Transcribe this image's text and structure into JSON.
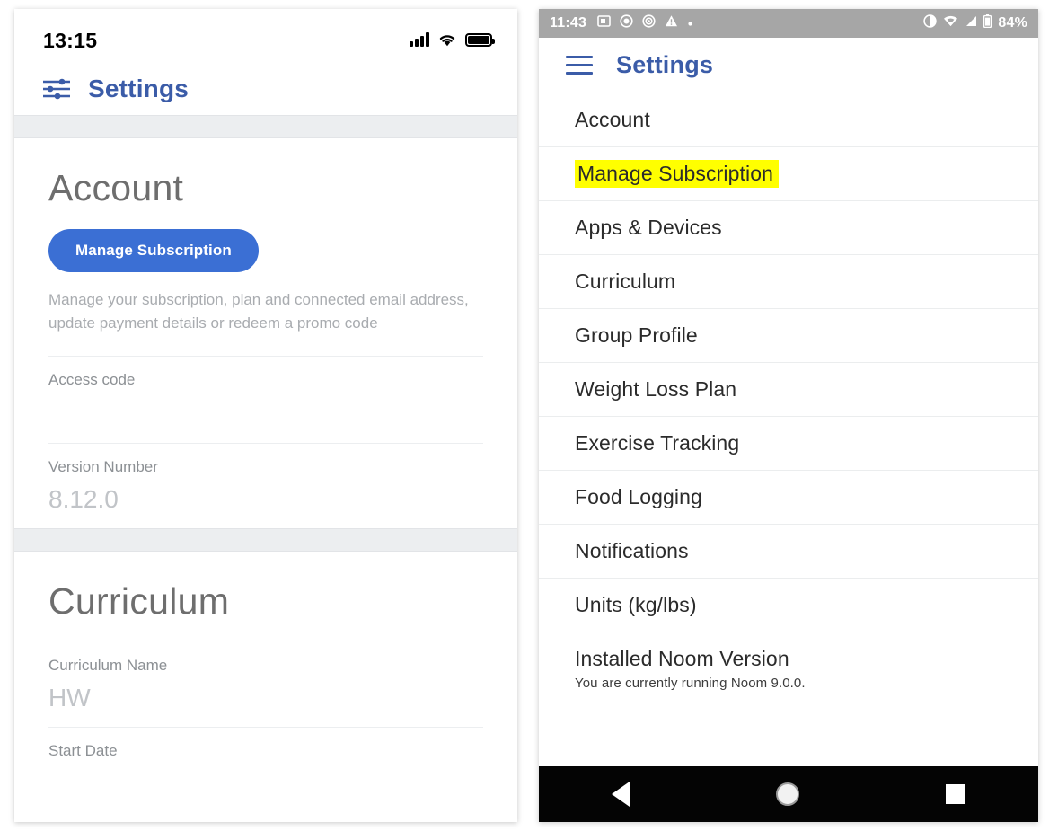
{
  "ios": {
    "status_bar": {
      "time": "13:15",
      "icons": [
        "cellular-signal-icon",
        "wifi-icon",
        "battery-icon"
      ]
    },
    "header": {
      "icon": "sliders-settings-icon",
      "title": "Settings"
    },
    "sections": [
      {
        "heading": "Account",
        "button_label": "Manage Subscription",
        "description": "Manage your subscription, plan and connected email address, update payment details or redeem a promo code",
        "fields": [
          {
            "label": "Access code",
            "value": ""
          },
          {
            "label": "Version Number",
            "value": "8.12.0"
          }
        ]
      },
      {
        "heading": "Curriculum",
        "fields": [
          {
            "label": "Curriculum Name",
            "value": "HW"
          },
          {
            "label": "Start Date",
            "value": ""
          }
        ]
      }
    ],
    "colors": {
      "accent": "#3b5ca8",
      "button": "#3b6fd4",
      "muted_text": "#a9acb0",
      "divider": "#eceef0"
    }
  },
  "android": {
    "status_bar": {
      "time": "11:43",
      "battery_percent": "84%",
      "left_icons": [
        "screenshot-icon",
        "sync-circle-icon",
        "location-circle-icon",
        "warning-triangle-icon",
        "dot-icon"
      ],
      "right_icons": [
        "do-not-disturb-icon",
        "wifi-icon",
        "cellular-signal-icon",
        "battery-icon"
      ]
    },
    "header": {
      "menu_icon": "hamburger-menu-icon",
      "title": "Settings"
    },
    "list": [
      {
        "label": "Account",
        "highlighted": false,
        "sub": ""
      },
      {
        "label": "Manage Subscription",
        "highlighted": true,
        "sub": ""
      },
      {
        "label": "Apps & Devices",
        "highlighted": false,
        "sub": ""
      },
      {
        "label": "Curriculum",
        "highlighted": false,
        "sub": ""
      },
      {
        "label": "Group Profile",
        "highlighted": false,
        "sub": ""
      },
      {
        "label": "Weight Loss Plan",
        "highlighted": false,
        "sub": ""
      },
      {
        "label": "Exercise Tracking",
        "highlighted": false,
        "sub": ""
      },
      {
        "label": "Food Logging",
        "highlighted": false,
        "sub": ""
      },
      {
        "label": "Notifications",
        "highlighted": false,
        "sub": ""
      },
      {
        "label": "Units (kg/lbs)",
        "highlighted": false,
        "sub": ""
      },
      {
        "label": "Installed Noom Version",
        "highlighted": false,
        "sub": "You are currently running Noom 9.0.0."
      }
    ],
    "nav_bar": {
      "back": "back-triangle-icon",
      "home": "home-circle-icon",
      "recents": "recents-square-icon"
    },
    "colors": {
      "status_bar_bg": "#a6a6a6",
      "accent": "#3b5ca8",
      "highlight": "#ffff00",
      "nav_bar_bg": "#040404"
    }
  }
}
